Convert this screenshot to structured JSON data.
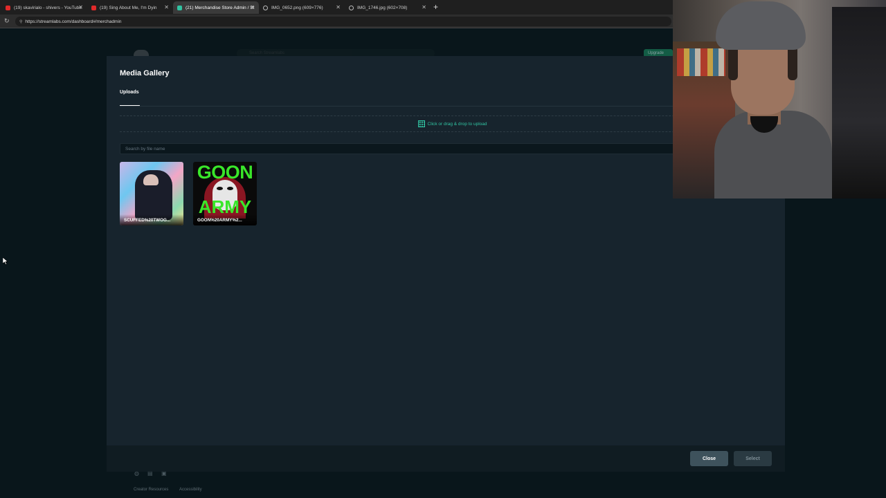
{
  "browser": {
    "tabs": [
      {
        "title": "(19) skavirialo - shivers - YouTube",
        "icon": "youtube-icon"
      },
      {
        "title": "(19) Sing About Me, I'm Dyin",
        "icon": "youtube-icon"
      },
      {
        "title": "(21) Merchandise Store Admin / St",
        "icon": "streamlabs-icon"
      },
      {
        "title": "IMG_0652.png (609×776)",
        "icon": "globe-icon"
      },
      {
        "title": "IMG_1746.jpg (602×708)",
        "icon": "globe-icon"
      }
    ],
    "url": "https://streamlabs.com/dashboard#/merchadmin"
  },
  "background_page": {
    "search_placeholder": "Search Streamlabs",
    "green_button": "Upgrade",
    "footer_links": [
      "Creator Resources",
      "Accessibility"
    ]
  },
  "modal": {
    "title": "Media Gallery",
    "tab": "Uploads",
    "upload_text": "Click or drag & drop to upload",
    "search_placeholder": "Search by file name",
    "files": [
      {
        "name": "SCUFFED%20TWOG..."
      },
      {
        "name": "GOON%20ARMY%2..."
      }
    ],
    "thumb2_text": {
      "top": "GOON",
      "bottom": "ARMY"
    },
    "buttons": {
      "close": "Close",
      "select": "Select"
    }
  },
  "colors": {
    "accent": "#31c3a2",
    "modal_bg": "#17242d",
    "goon_green": "#39e62a"
  }
}
